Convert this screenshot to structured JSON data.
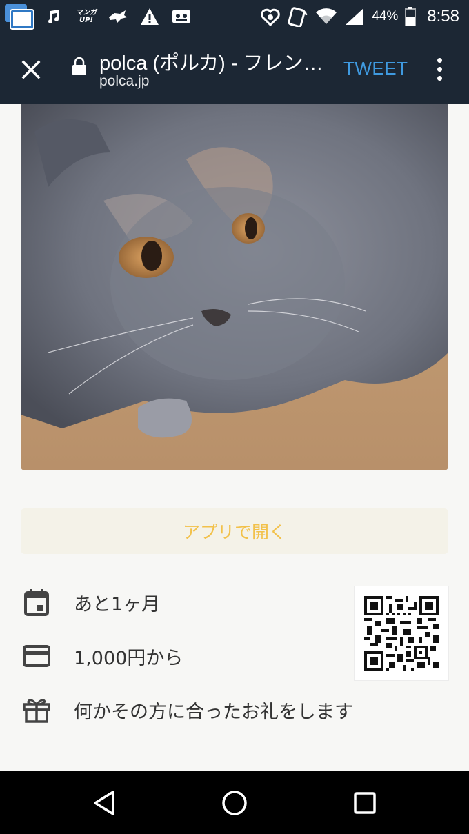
{
  "status_bar": {
    "notification_icons": [
      "multi-window-icon",
      "music-note-icon",
      "manga-up-icon",
      "bird-icon",
      "warning-icon",
      "cassette-icon"
    ],
    "manga_app_text": [
      "マンガ",
      "UP!"
    ],
    "right_icons": [
      "heart-shield-icon",
      "nfc-icon",
      "wifi-icon",
      "signal-icon",
      "battery-icon"
    ],
    "battery": "44%",
    "time": "8:58"
  },
  "toolbar": {
    "title": "polca (ポルカ) - フレン…",
    "url": "polca.jp",
    "tweet_label": "TWEET"
  },
  "content": {
    "open_app_label": "アプリで開く",
    "info": [
      {
        "icon": "calendar-icon",
        "text": "あと1ヶ月"
      },
      {
        "icon": "card-icon",
        "text": "1,000円から"
      },
      {
        "icon": "gift-icon",
        "text": "何かその方に合ったお礼をします"
      }
    ]
  },
  "colors": {
    "header_bg": "#1c2734",
    "tweet_blue": "#3f9ae0",
    "open_app_text": "#f2c14a",
    "page_bg": "#f7f7f5"
  }
}
